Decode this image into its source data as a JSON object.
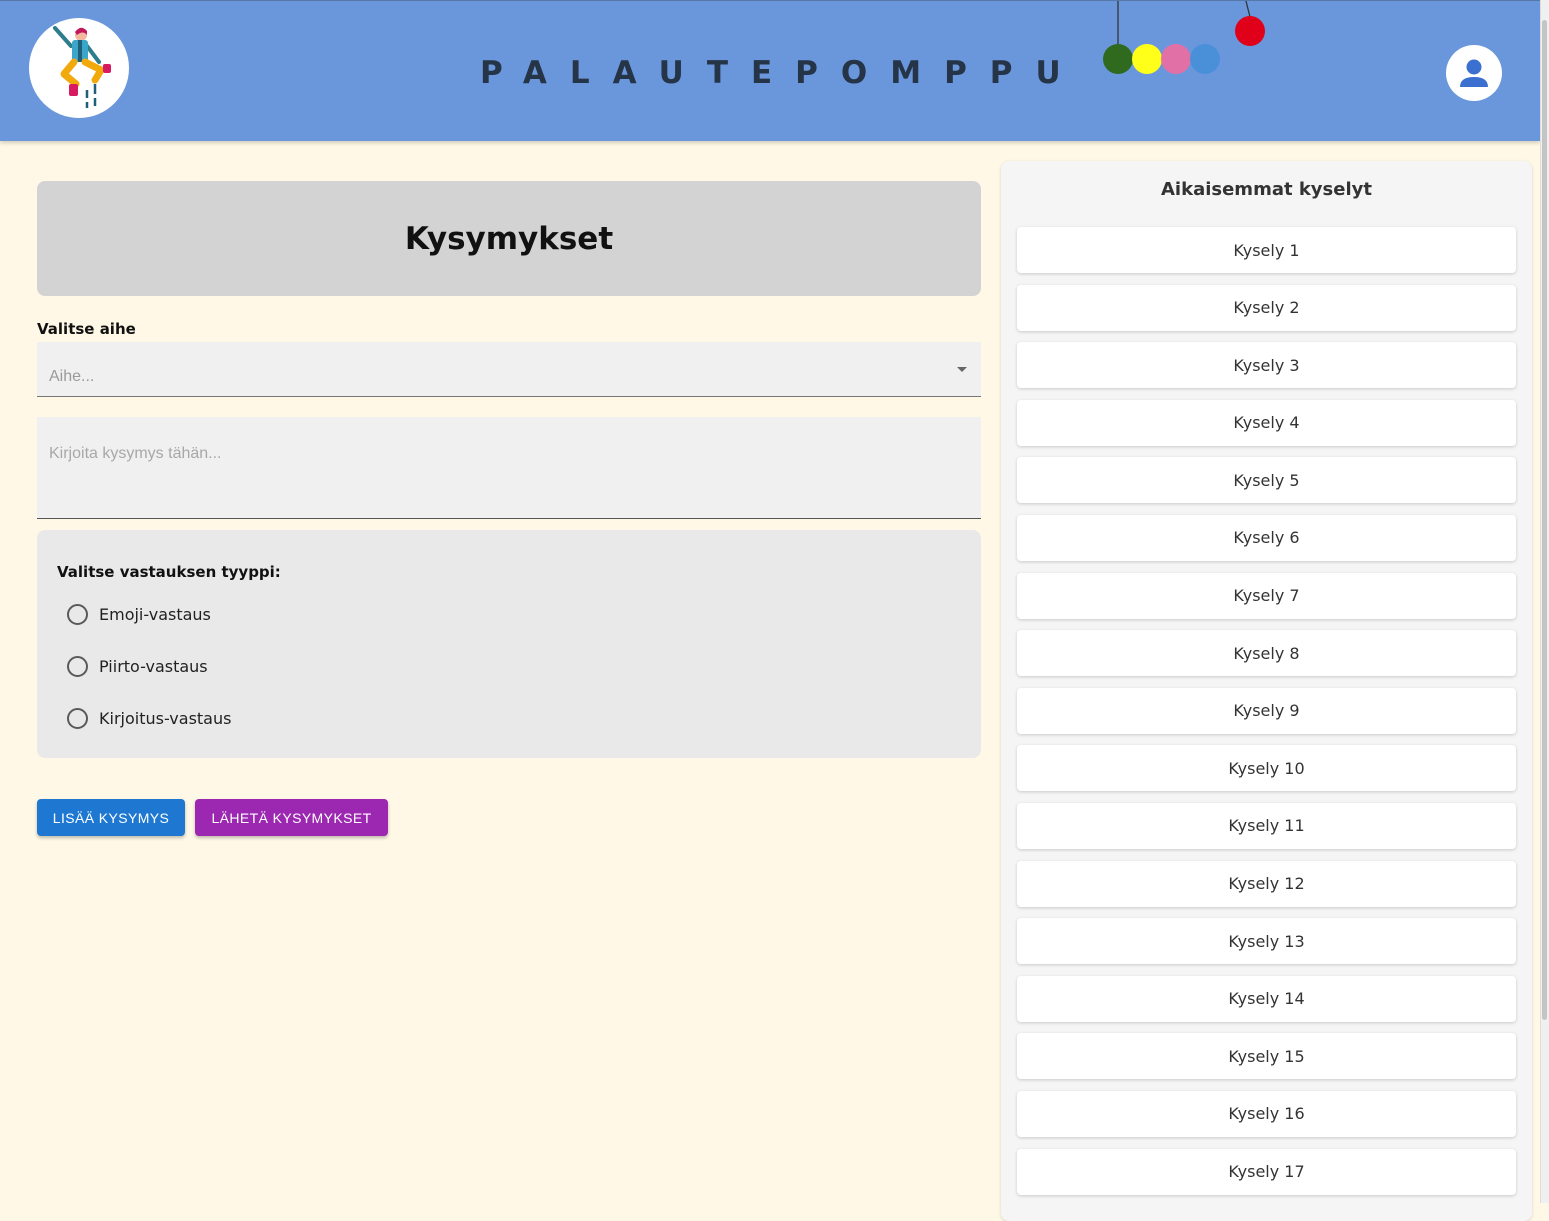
{
  "header": {
    "title": "PALAUTEPOMPPU",
    "logo_icon": "jumping-person-logo-icon",
    "user_icon": "user-account-icon",
    "colors": {
      "header_bg": "#6a97dc",
      "title_text": "#253447"
    }
  },
  "decor_balls": {
    "colors": [
      "#2f6a1f",
      "#ffff1a",
      "#e070a5",
      "#4a90d9",
      "#e0001a"
    ]
  },
  "main": {
    "heading": "Kysymykset",
    "topic": {
      "label": "Valitse aihe",
      "placeholder": "Aihe..."
    },
    "question": {
      "placeholder": "Kirjoita kysymys tähän..."
    },
    "answer_type": {
      "title": "Valitse vastauksen tyyppi:",
      "options": [
        {
          "label": "Emoji-vastaus"
        },
        {
          "label": "Piirto-vastaus"
        },
        {
          "label": "Kirjoitus-vastaus"
        }
      ]
    },
    "buttons": {
      "add_label": "LISÄÄ KYSYMYS",
      "send_label": "LÄHETÄ KYSYMYKSET",
      "add_color": "#1e78d2",
      "send_color": "#9c27b0"
    }
  },
  "sidebar": {
    "title": "Aikaisemmat kyselyt",
    "items": [
      {
        "label": "Kysely 1"
      },
      {
        "label": "Kysely 2"
      },
      {
        "label": "Kysely 3"
      },
      {
        "label": "Kysely 4"
      },
      {
        "label": "Kysely 5"
      },
      {
        "label": "Kysely 6"
      },
      {
        "label": "Kysely 7"
      },
      {
        "label": "Kysely 8"
      },
      {
        "label": "Kysely 9"
      },
      {
        "label": "Kysely 10"
      },
      {
        "label": "Kysely 11"
      },
      {
        "label": "Kysely 12"
      },
      {
        "label": "Kysely 13"
      },
      {
        "label": "Kysely 14"
      },
      {
        "label": "Kysely 15"
      },
      {
        "label": "Kysely 16"
      },
      {
        "label": "Kysely 17"
      }
    ]
  },
  "page_background": "#fff8e6"
}
